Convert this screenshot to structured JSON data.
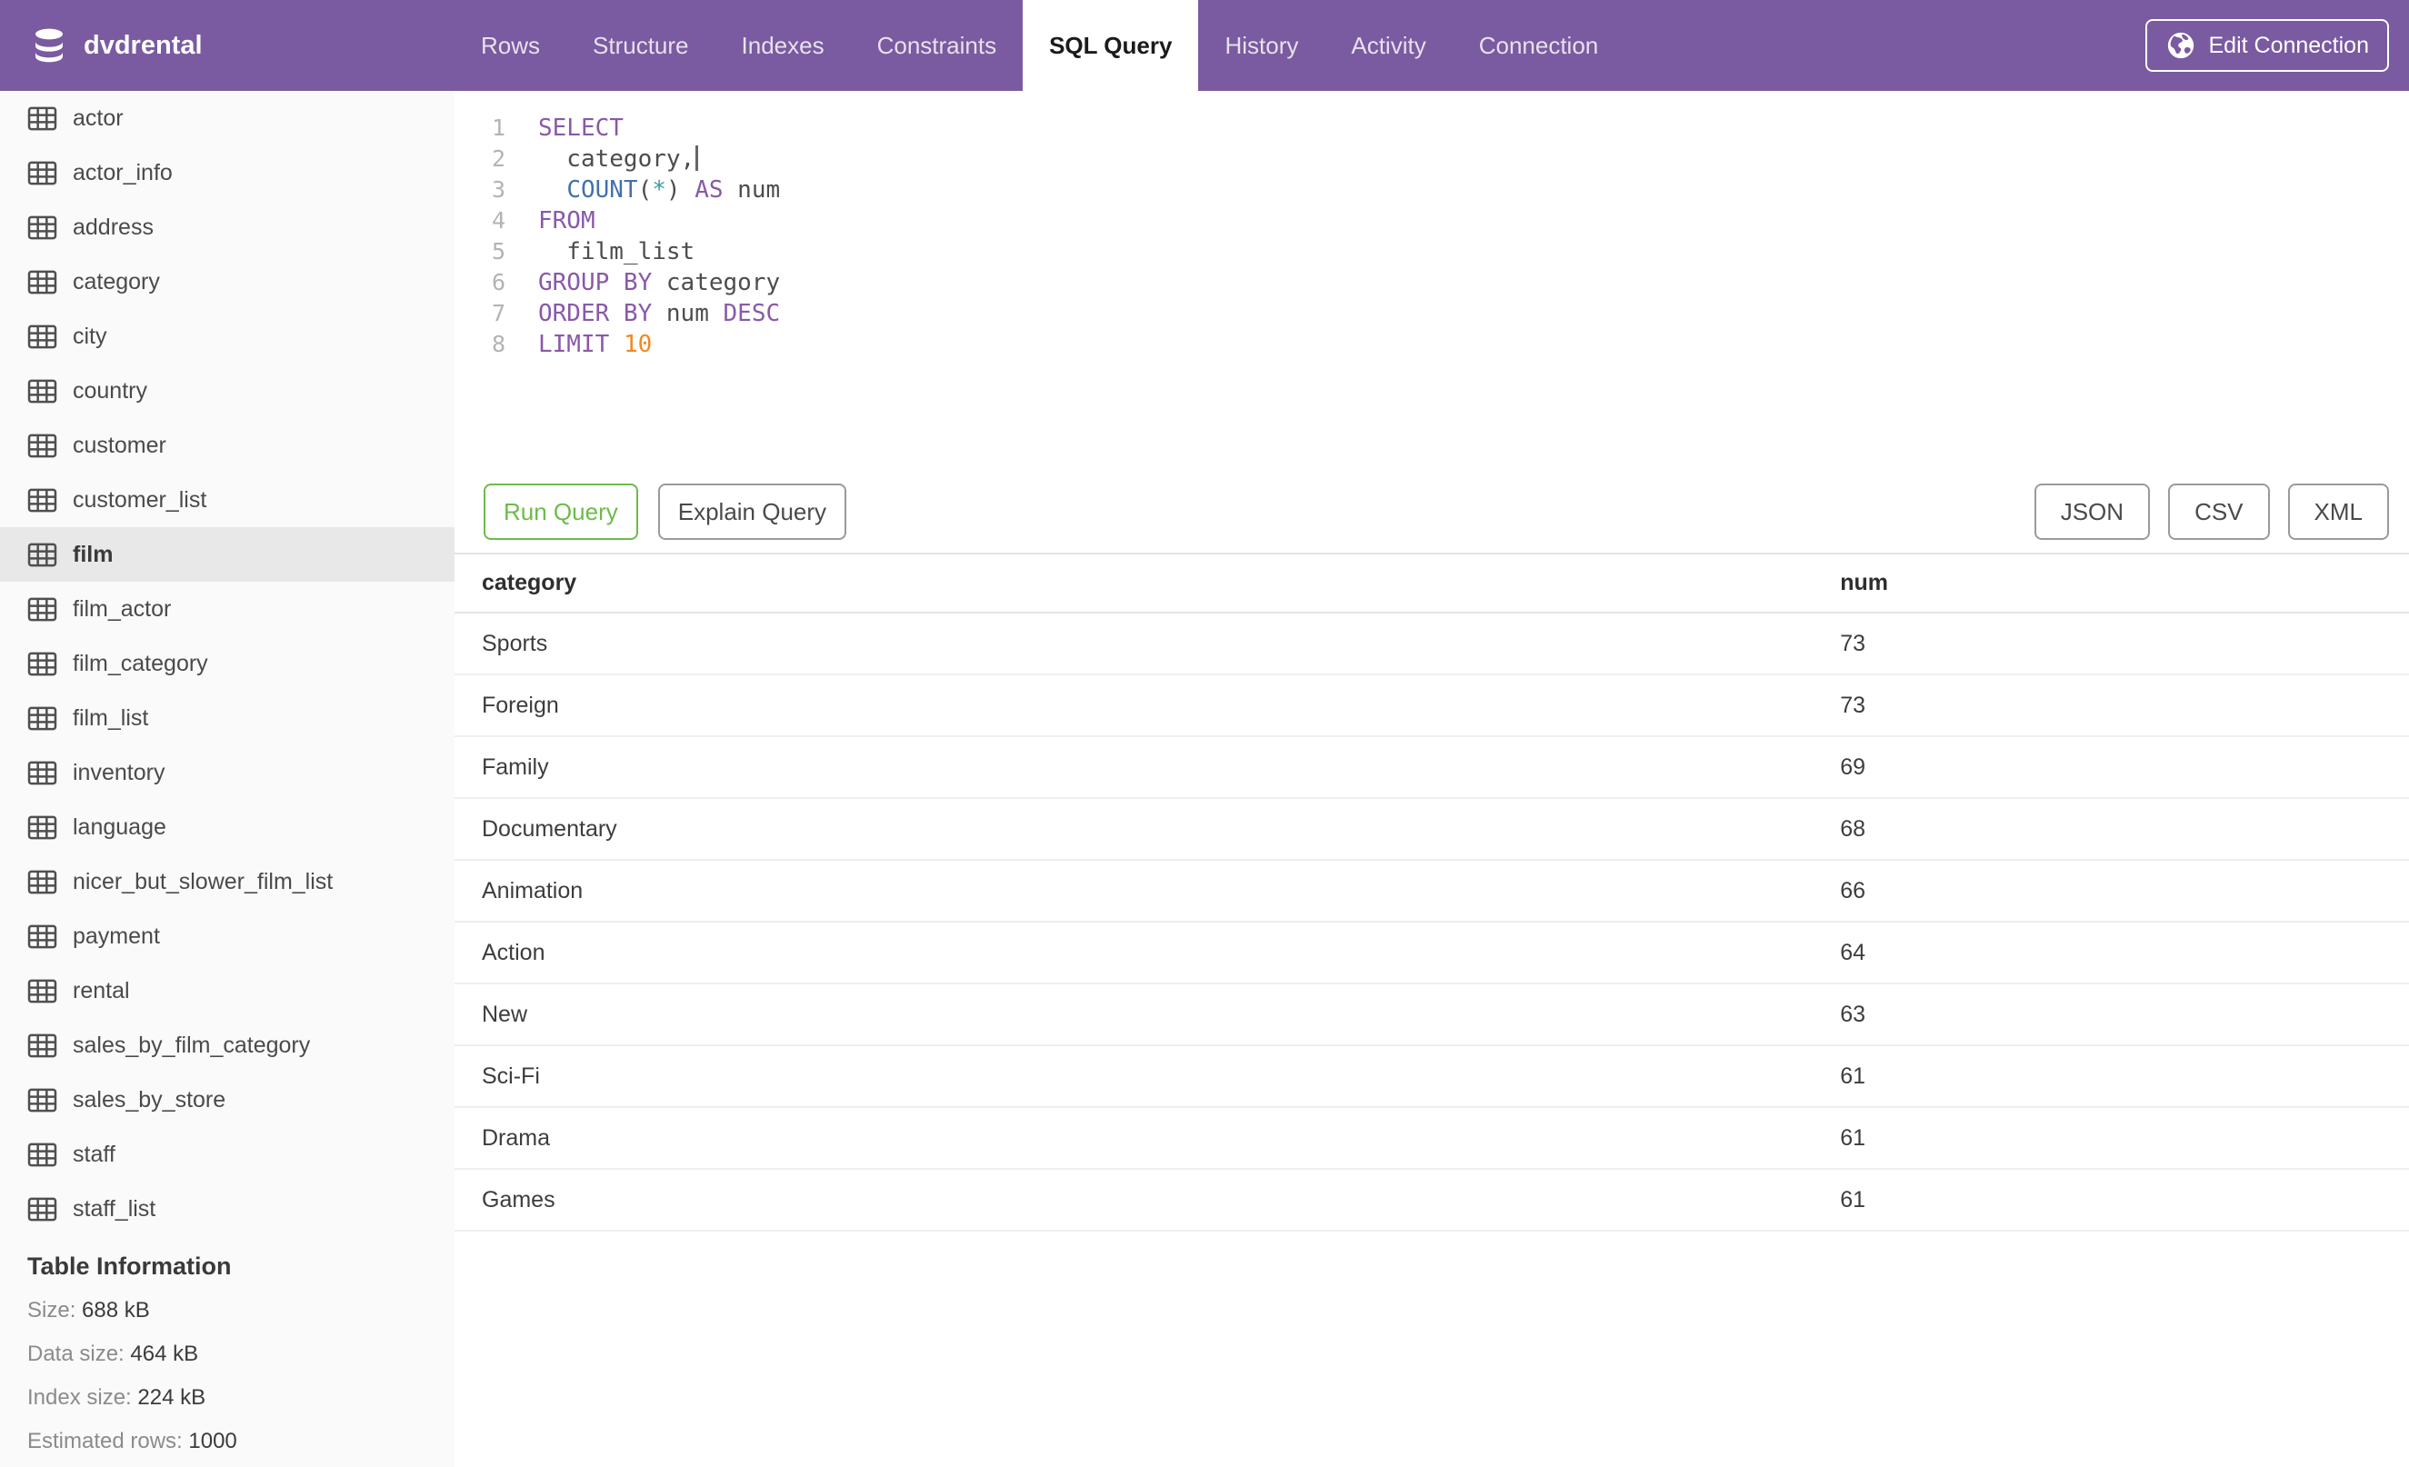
{
  "header": {
    "brand": "dvdrental",
    "tabs": [
      "Rows",
      "Structure",
      "Indexes",
      "Constraints",
      "SQL Query",
      "History",
      "Activity",
      "Connection"
    ],
    "active_tab": "SQL Query",
    "edit_connection": "Edit Connection"
  },
  "sidebar": {
    "tables": [
      "actor",
      "actor_info",
      "address",
      "category",
      "city",
      "country",
      "customer",
      "customer_list",
      "film",
      "film_actor",
      "film_category",
      "film_list",
      "inventory",
      "language",
      "nicer_but_slower_film_list",
      "payment",
      "rental",
      "sales_by_film_category",
      "sales_by_store",
      "staff",
      "staff_list"
    ],
    "selected_table": "film",
    "table_information": {
      "heading": "Table Information",
      "stats": [
        {
          "label": "Size:",
          "value": "688 kB"
        },
        {
          "label": "Data size:",
          "value": "464 kB"
        },
        {
          "label": "Index size:",
          "value": "224 kB"
        },
        {
          "label": "Estimated rows:",
          "value": "1000"
        }
      ]
    }
  },
  "editor": {
    "lines": [
      [
        {
          "t": "SELECT",
          "c": "kw"
        }
      ],
      [
        {
          "t": "  category,",
          "c": "txt"
        },
        {
          "cursor": true
        }
      ],
      [
        {
          "t": "  ",
          "c": "txt"
        },
        {
          "t": "COUNT",
          "c": "fn"
        },
        {
          "t": "(",
          "c": "txt"
        },
        {
          "t": "*",
          "c": "op"
        },
        {
          "t": ") ",
          "c": "txt"
        },
        {
          "t": "AS",
          "c": "kw"
        },
        {
          "t": " num",
          "c": "txt"
        }
      ],
      [
        {
          "t": "FROM",
          "c": "kw"
        }
      ],
      [
        {
          "t": "  film_list",
          "c": "txt"
        }
      ],
      [
        {
          "t": "GROUP BY",
          "c": "kw"
        },
        {
          "t": " category",
          "c": "txt"
        }
      ],
      [
        {
          "t": "ORDER BY",
          "c": "kw"
        },
        {
          "t": " num ",
          "c": "txt"
        },
        {
          "t": "DESC",
          "c": "kw"
        }
      ],
      [
        {
          "t": "LIMIT",
          "c": "kw"
        },
        {
          "t": " ",
          "c": "txt"
        },
        {
          "t": "10",
          "c": "num"
        }
      ]
    ]
  },
  "actions": {
    "run": "Run Query",
    "explain": "Explain Query",
    "export_formats": [
      "JSON",
      "CSV",
      "XML"
    ]
  },
  "results": {
    "columns": [
      "category",
      "num"
    ],
    "rows": [
      [
        "Sports",
        "73"
      ],
      [
        "Foreign",
        "73"
      ],
      [
        "Family",
        "69"
      ],
      [
        "Documentary",
        "68"
      ],
      [
        "Animation",
        "66"
      ],
      [
        "Action",
        "64"
      ],
      [
        "New",
        "63"
      ],
      [
        "Sci-Fi",
        "61"
      ],
      [
        "Drama",
        "61"
      ],
      [
        "Games",
        "61"
      ]
    ]
  },
  "colors": {
    "navbar": "#7A5AA0",
    "accent_green": "#6DBB4A",
    "syntax_keyword": "#8959A8",
    "syntax_function": "#4271AE",
    "syntax_operator": "#3E999F",
    "syntax_number": "#F5871F",
    "syntax_text": "#4D4D4C"
  }
}
